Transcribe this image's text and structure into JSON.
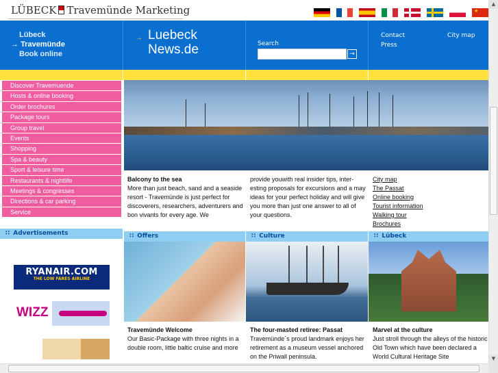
{
  "header": {
    "logo_left": "LÜBECK",
    "logo_right": "Travemünde Marketing",
    "languages": [
      "Deutsch",
      "Français",
      "Español",
      "Italiano",
      "Dansk",
      "Svenska",
      "Polski",
      "中文"
    ]
  },
  "topnav": {
    "items": [
      "Lübeck",
      "Travemünde",
      "Book online"
    ],
    "active": "Travemünde",
    "news_line1": "Luebeck",
    "news_line2": "News.de",
    "search_label": "Search",
    "search_value": "",
    "search_button": "→",
    "contact": "Contact",
    "press": "Press",
    "city_map": "City map"
  },
  "sidebar": {
    "menu": [
      "Discover Travemuende",
      "Hosts & online booking",
      "Order brochures",
      "Package tours",
      "Group travel",
      "Events",
      "Shopping",
      "Spa & beauty",
      "Sport & leisure time",
      "Restaurants & nightlife",
      "Meetings & congresses",
      "Directions & car parking",
      "Service"
    ],
    "ads_title": "Advertisements",
    "ad_ryanair": "RYANAIR.COM",
    "ad_ryanair_tagline": "THE LOW FARES AIRLINE",
    "ad_wizz": "WIZZ"
  },
  "intro": {
    "title": "Balcony to the sea",
    "col1": "More than just beach, sand and a seaside resort - Travemünde is just perfect for discoverers, researchers, adventurers and bon vivants for every age. We",
    "col2": "provide youwith real insider tips, inter-esting proposals for excursions and a may ideas for your perfect holiday and will give you more than just one answer to all of your questions.",
    "links": [
      "City map",
      "The Passat",
      "Online booking",
      "Tourist information",
      "Walking tour",
      "Brochures"
    ]
  },
  "sections": [
    {
      "heading": "Offers",
      "title": "Travemünde Welcome",
      "text": "Our Basic-Package with three nights in a double room, little baltic cruise and more"
    },
    {
      "heading": "Culture",
      "title": "The four-masted retiree: Passat",
      "text": "Travemünde´s proud landmark enjoys her retirement as a museum vessel anchored on the Priwall peninsula."
    },
    {
      "heading": "Lübeck",
      "title": "Marvel at the culture",
      "text": "Just stroll through the alleys of the historic Old Town which have been declared a World Cultural Heritage Site"
    }
  ],
  "colors": {
    "blue": "#0a6fcf",
    "yellow": "#ffe03c",
    "pink": "#ef5d9e",
    "section_head": "#8fcdf2"
  }
}
